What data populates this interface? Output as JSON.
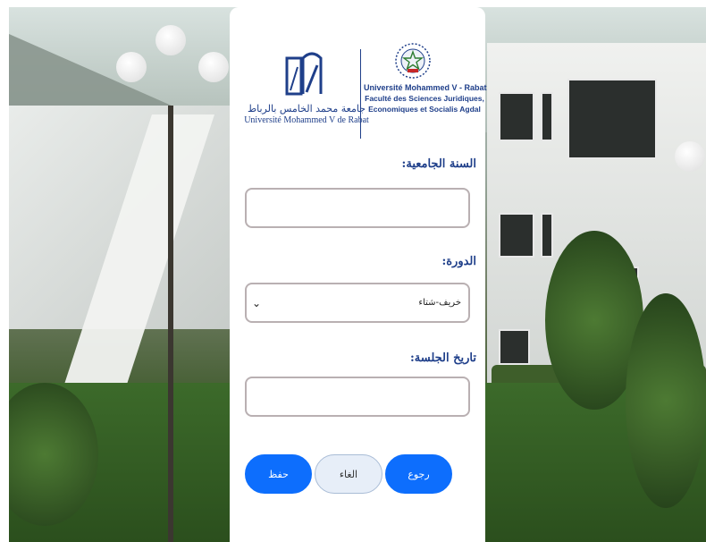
{
  "logos": {
    "left_arabic": "جامعة محمد الخامس بالرباط",
    "left_french": "Université Mohammed V de Rabat",
    "right_line1": "Université Mohammed V - Rabat",
    "right_line2": "Faculté des Sciences Juridiques,",
    "right_line3": "Economiques et Socialis  Agdal",
    "color": "#1f3f8a"
  },
  "form": {
    "academic_year_label": "السنة الجامعية:",
    "academic_year_value": "",
    "session_label": "الدورة:",
    "session_value": "خريف-شتاء",
    "date_label": "تاريخ الجلسة:",
    "date_value": ""
  },
  "buttons": {
    "back": "رجوع",
    "cancel": "الغاء",
    "save": "حفظ"
  },
  "colors": {
    "primary": "#0d6efd",
    "label": "#1f3f8a",
    "border": "#b9b0b2"
  }
}
